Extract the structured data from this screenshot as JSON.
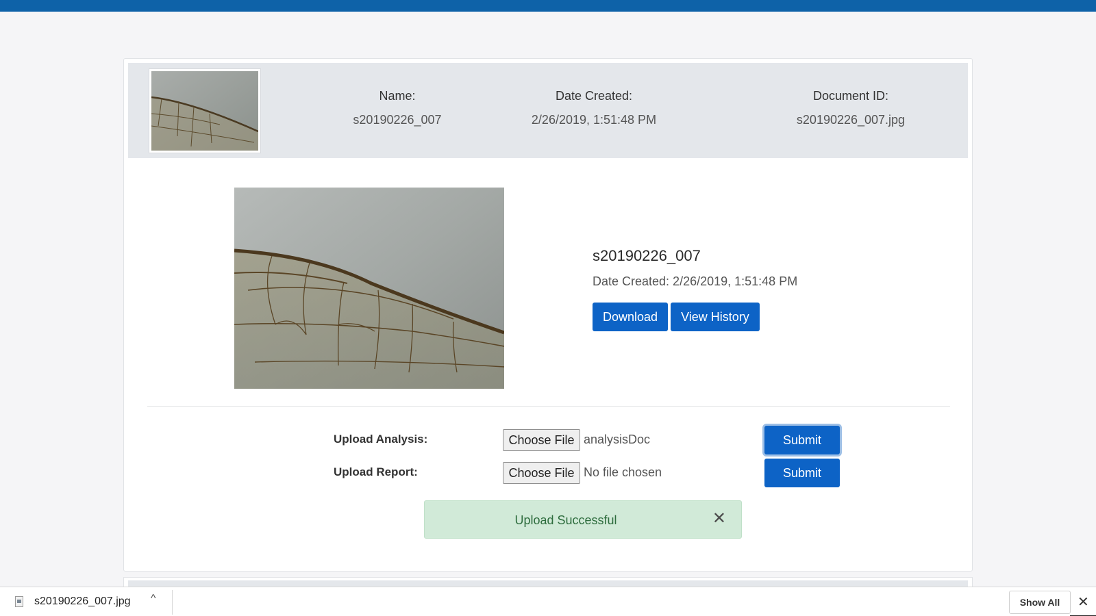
{
  "document": {
    "header": {
      "name_label": "Name:",
      "name_value": "s20190226_007",
      "date_label": "Date Created:",
      "date_value": "2/26/2019, 1:51:48 PM",
      "doc_label": "Document ID:",
      "doc_value": "s20190226_007.jpg"
    },
    "detail": {
      "title": "s20190226_007",
      "date_text": "Date Created: 2/26/2019, 1:51:48 PM",
      "download_label": "Download",
      "history_label": "View History"
    }
  },
  "uploads": [
    {
      "label": "Upload Analysis:",
      "choose_label": "Choose File",
      "file_name": "analysisDoc",
      "submit_label": "Submit"
    },
    {
      "label": "Upload Report:",
      "choose_label": "Choose File",
      "file_name": "No file chosen",
      "submit_label": "Submit"
    }
  ],
  "alert": {
    "message": "Upload Successful",
    "close_glyph": "✕"
  },
  "download_bar": {
    "file_name": "s20190226_007.jpg",
    "chevron_glyph": "^",
    "show_all_label": "Show All",
    "close_glyph": "✕"
  },
  "colors": {
    "topbar": "#0e62a8",
    "primary_button": "#0d63c6",
    "alert_bg": "#d1ead8",
    "alert_text": "#2d6c3d",
    "header_strip": "#e4e7eb"
  },
  "icons": [
    "file-icon",
    "chevron-up-icon",
    "close-icon",
    "wing-image"
  ]
}
